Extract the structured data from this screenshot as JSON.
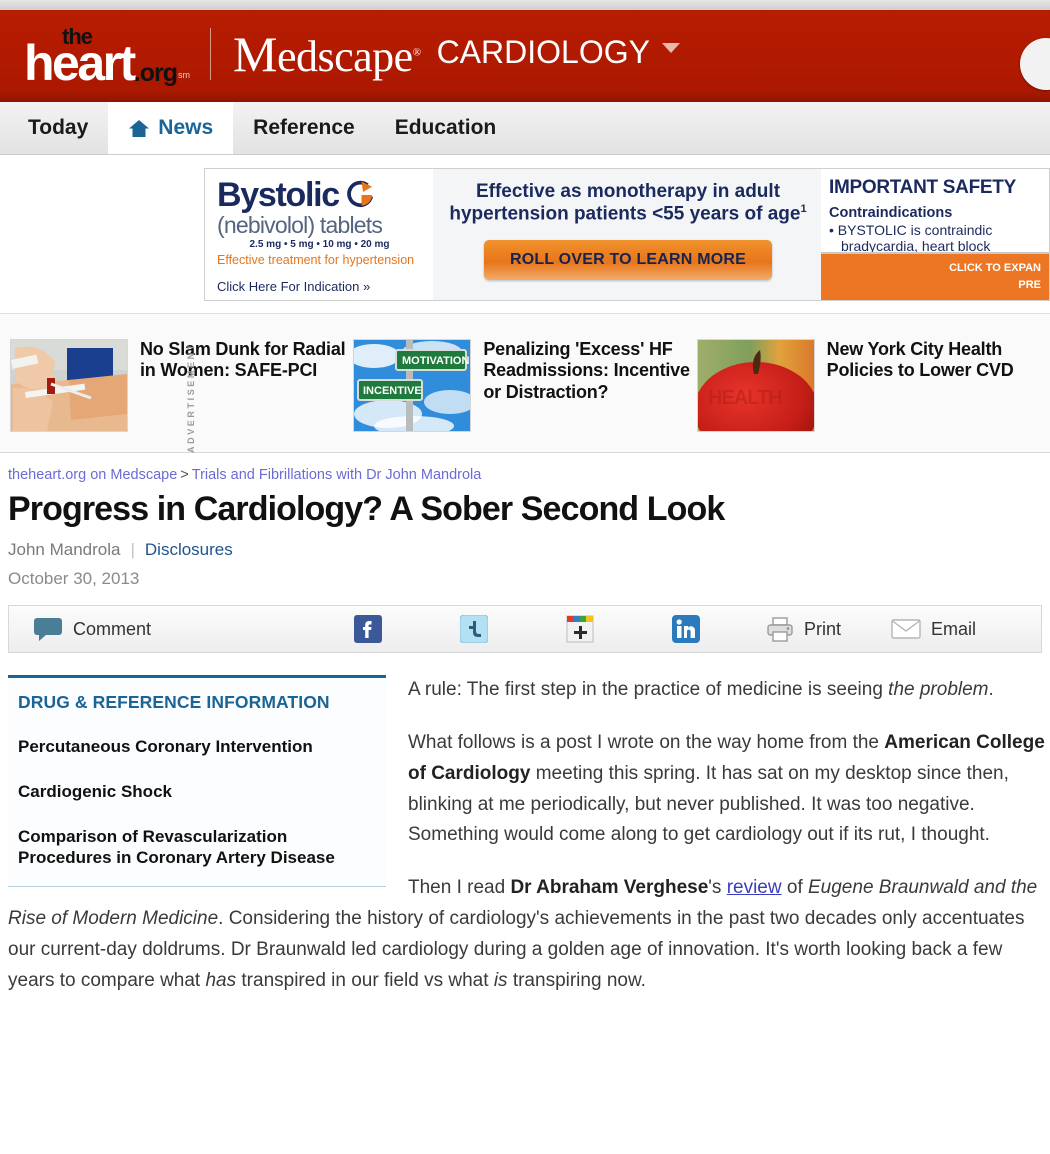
{
  "masthead": {
    "logo_the": "the",
    "logo_heart": "heart",
    "logo_org": ".org",
    "logo_sm": "sm",
    "brand_cap": "M",
    "brand_rest": "edscape",
    "brand_reg": "®",
    "specialty": "CARDIOLOGY",
    "brand_color": "#b21b00",
    "search_icon": "search-icon"
  },
  "nav": {
    "tabs": [
      {
        "label": "Today",
        "active": false,
        "icon": ""
      },
      {
        "label": "News",
        "active": true,
        "icon": "home-icon"
      },
      {
        "label": "Reference",
        "active": false,
        "icon": ""
      },
      {
        "label": "Education",
        "active": false,
        "icon": ""
      }
    ]
  },
  "ad": {
    "vertical_label": "ADVERTISEMENT",
    "brand": "Bystolic",
    "subtitle": "(nebivolol) tablets",
    "doses": "2.5 mg • 5 mg • 10 mg • 20 mg",
    "tagline": "Effective treatment for hypertension",
    "indication_link": "Click Here For Indication »",
    "headline_line1": "Effective as monotherapy in adult",
    "headline_line2": "hypertension patients <55 years of age",
    "headline_sup": "1",
    "cta": "ROLL OVER TO LEARN MORE",
    "isi_title": "IMPORTANT SAFETY",
    "isi_subtitle": "Contraindications",
    "isi_body": "• BYSTOLIC is contraindic bradycardia, heart block cardiogenic shock, decom",
    "expand_line1": "CLICK TO EXPAN",
    "expand_line2": "PRE",
    "navy": "#1b2a5e",
    "orange": "#e8751a"
  },
  "teasers": [
    {
      "title": "No Slam Dunk for Radial in Women: SAFE-PCI",
      "thumb_name": "radial-access-procedure-thumbnail"
    },
    {
      "title": "Penalizing 'Excess' HF Readmissions: Incentive or Distraction?",
      "thumb_name": "motivation-incentive-signs-thumbnail",
      "sign_top": "MOTIVATION",
      "sign_bottom": "INCENTIVE"
    },
    {
      "title": "New York City Health Policies to Lower CVD",
      "thumb_name": "health-apple-thumbnail",
      "apple_text": "HEALTH"
    }
  ],
  "article": {
    "breadcrumb_root": "theheart.org on Medscape",
    "breadcrumb_sep": ">",
    "breadcrumb_leaf": "Trials and Fibrillations with Dr John Mandrola",
    "title": "Progress in Cardiology? A Sober Second Look",
    "author": "John Mandrola",
    "disclosures": "Disclosures",
    "date": "October 30, 2013"
  },
  "share": {
    "comment_label": "Comment",
    "facebook_icon": "facebook-icon",
    "twitter_icon": "twitter-icon",
    "addthis_icon": "addthis-icon",
    "linkedin_icon": "linkedin-icon",
    "print_label": "Print",
    "email_label": "Email"
  },
  "sidebar": {
    "heading": "DRUG & REFERENCE INFORMATION",
    "links": [
      "Percutaneous Coronary Intervention",
      "Cardiogenic Shock",
      "Comparison of Revascularization Procedures in Coronary Artery Disease"
    ]
  },
  "body": {
    "p1_a": "A rule: The first step in the practice of medicine is seeing ",
    "p1_i": "the problem",
    "p1_b": ".",
    "p2_a": "What follows is a post I wrote on the way home from the ",
    "p2_bold": "American College of Cardiology",
    "p2_b": " meeting this spring. It has sat on my desktop since then, blinking at me periodically, but never published. It was too negative. Something would come along to get cardiology out if its rut, I thought.",
    "p3_a": "Then I read ",
    "p3_bold": "Dr Abraham Verghese",
    "p3_b": "'s ",
    "p3_link": "review",
    "p3_c": " of ",
    "p3_italic": "Eugene Braunwald and the Rise of Modern Medicine",
    "p3_d": ". Considering the history of cardiology's achievements in the past two decades only accentuates our current-day doldrums. Dr Braunwald led cardiology during a golden age of innovation. It's worth looking back a few years to compare what ",
    "p3_i2": "has",
    "p3_e": " transpired in our field vs what ",
    "p3_i3": "is",
    "p3_f": " transpiring now."
  }
}
